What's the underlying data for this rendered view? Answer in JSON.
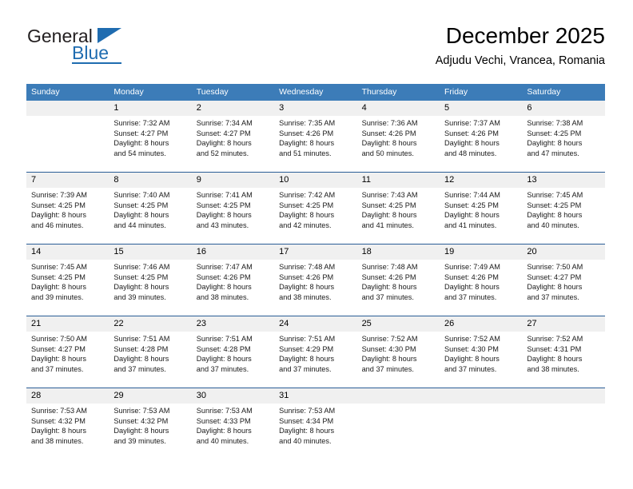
{
  "logo": {
    "text_top": "General",
    "text_bottom": "Blue",
    "accent_color": "#1f6cb0",
    "triangle_icon": "triangle-icon"
  },
  "header": {
    "month_title": "December 2025",
    "location": "Adjudu Vechi, Vrancea, Romania"
  },
  "theme": {
    "header_blue": "#3c7cb8",
    "rule_blue": "#2a5d96",
    "date_band_gray": "#f0f0f0"
  },
  "calendar": {
    "weekday_headers": [
      "Sunday",
      "Monday",
      "Tuesday",
      "Wednesday",
      "Thursday",
      "Friday",
      "Saturday"
    ],
    "weeks": [
      [
        {
          "date": "",
          "lines": [
            "",
            "",
            "",
            ""
          ],
          "blank": true
        },
        {
          "date": "1",
          "lines": [
            "Sunrise: 7:32 AM",
            "Sunset: 4:27 PM",
            "Daylight: 8 hours",
            "and 54 minutes."
          ]
        },
        {
          "date": "2",
          "lines": [
            "Sunrise: 7:34 AM",
            "Sunset: 4:27 PM",
            "Daylight: 8 hours",
            "and 52 minutes."
          ]
        },
        {
          "date": "3",
          "lines": [
            "Sunrise: 7:35 AM",
            "Sunset: 4:26 PM",
            "Daylight: 8 hours",
            "and 51 minutes."
          ]
        },
        {
          "date": "4",
          "lines": [
            "Sunrise: 7:36 AM",
            "Sunset: 4:26 PM",
            "Daylight: 8 hours",
            "and 50 minutes."
          ]
        },
        {
          "date": "5",
          "lines": [
            "Sunrise: 7:37 AM",
            "Sunset: 4:26 PM",
            "Daylight: 8 hours",
            "and 48 minutes."
          ]
        },
        {
          "date": "6",
          "lines": [
            "Sunrise: 7:38 AM",
            "Sunset: 4:25 PM",
            "Daylight: 8 hours",
            "and 47 minutes."
          ]
        }
      ],
      [
        {
          "date": "7",
          "lines": [
            "Sunrise: 7:39 AM",
            "Sunset: 4:25 PM",
            "Daylight: 8 hours",
            "and 46 minutes."
          ]
        },
        {
          "date": "8",
          "lines": [
            "Sunrise: 7:40 AM",
            "Sunset: 4:25 PM",
            "Daylight: 8 hours",
            "and 44 minutes."
          ]
        },
        {
          "date": "9",
          "lines": [
            "Sunrise: 7:41 AM",
            "Sunset: 4:25 PM",
            "Daylight: 8 hours",
            "and 43 minutes."
          ]
        },
        {
          "date": "10",
          "lines": [
            "Sunrise: 7:42 AM",
            "Sunset: 4:25 PM",
            "Daylight: 8 hours",
            "and 42 minutes."
          ]
        },
        {
          "date": "11",
          "lines": [
            "Sunrise: 7:43 AM",
            "Sunset: 4:25 PM",
            "Daylight: 8 hours",
            "and 41 minutes."
          ]
        },
        {
          "date": "12",
          "lines": [
            "Sunrise: 7:44 AM",
            "Sunset: 4:25 PM",
            "Daylight: 8 hours",
            "and 41 minutes."
          ]
        },
        {
          "date": "13",
          "lines": [
            "Sunrise: 7:45 AM",
            "Sunset: 4:25 PM",
            "Daylight: 8 hours",
            "and 40 minutes."
          ]
        }
      ],
      [
        {
          "date": "14",
          "lines": [
            "Sunrise: 7:45 AM",
            "Sunset: 4:25 PM",
            "Daylight: 8 hours",
            "and 39 minutes."
          ]
        },
        {
          "date": "15",
          "lines": [
            "Sunrise: 7:46 AM",
            "Sunset: 4:25 PM",
            "Daylight: 8 hours",
            "and 39 minutes."
          ]
        },
        {
          "date": "16",
          "lines": [
            "Sunrise: 7:47 AM",
            "Sunset: 4:26 PM",
            "Daylight: 8 hours",
            "and 38 minutes."
          ]
        },
        {
          "date": "17",
          "lines": [
            "Sunrise: 7:48 AM",
            "Sunset: 4:26 PM",
            "Daylight: 8 hours",
            "and 38 minutes."
          ]
        },
        {
          "date": "18",
          "lines": [
            "Sunrise: 7:48 AM",
            "Sunset: 4:26 PM",
            "Daylight: 8 hours",
            "and 37 minutes."
          ]
        },
        {
          "date": "19",
          "lines": [
            "Sunrise: 7:49 AM",
            "Sunset: 4:26 PM",
            "Daylight: 8 hours",
            "and 37 minutes."
          ]
        },
        {
          "date": "20",
          "lines": [
            "Sunrise: 7:50 AM",
            "Sunset: 4:27 PM",
            "Daylight: 8 hours",
            "and 37 minutes."
          ]
        }
      ],
      [
        {
          "date": "21",
          "lines": [
            "Sunrise: 7:50 AM",
            "Sunset: 4:27 PM",
            "Daylight: 8 hours",
            "and 37 minutes."
          ]
        },
        {
          "date": "22",
          "lines": [
            "Sunrise: 7:51 AM",
            "Sunset: 4:28 PM",
            "Daylight: 8 hours",
            "and 37 minutes."
          ]
        },
        {
          "date": "23",
          "lines": [
            "Sunrise: 7:51 AM",
            "Sunset: 4:28 PM",
            "Daylight: 8 hours",
            "and 37 minutes."
          ]
        },
        {
          "date": "24",
          "lines": [
            "Sunrise: 7:51 AM",
            "Sunset: 4:29 PM",
            "Daylight: 8 hours",
            "and 37 minutes."
          ]
        },
        {
          "date": "25",
          "lines": [
            "Sunrise: 7:52 AM",
            "Sunset: 4:30 PM",
            "Daylight: 8 hours",
            "and 37 minutes."
          ]
        },
        {
          "date": "26",
          "lines": [
            "Sunrise: 7:52 AM",
            "Sunset: 4:30 PM",
            "Daylight: 8 hours",
            "and 37 minutes."
          ]
        },
        {
          "date": "27",
          "lines": [
            "Sunrise: 7:52 AM",
            "Sunset: 4:31 PM",
            "Daylight: 8 hours",
            "and 38 minutes."
          ]
        }
      ],
      [
        {
          "date": "28",
          "lines": [
            "Sunrise: 7:53 AM",
            "Sunset: 4:32 PM",
            "Daylight: 8 hours",
            "and 38 minutes."
          ]
        },
        {
          "date": "29",
          "lines": [
            "Sunrise: 7:53 AM",
            "Sunset: 4:32 PM",
            "Daylight: 8 hours",
            "and 39 minutes."
          ]
        },
        {
          "date": "30",
          "lines": [
            "Sunrise: 7:53 AM",
            "Sunset: 4:33 PM",
            "Daylight: 8 hours",
            "and 40 minutes."
          ]
        },
        {
          "date": "31",
          "lines": [
            "Sunrise: 7:53 AM",
            "Sunset: 4:34 PM",
            "Daylight: 8 hours",
            "and 40 minutes."
          ]
        },
        {
          "date": "",
          "lines": [
            "",
            "",
            "",
            ""
          ],
          "blank": true
        },
        {
          "date": "",
          "lines": [
            "",
            "",
            "",
            ""
          ],
          "blank": true
        },
        {
          "date": "",
          "lines": [
            "",
            "",
            "",
            ""
          ],
          "blank": true
        }
      ]
    ]
  }
}
